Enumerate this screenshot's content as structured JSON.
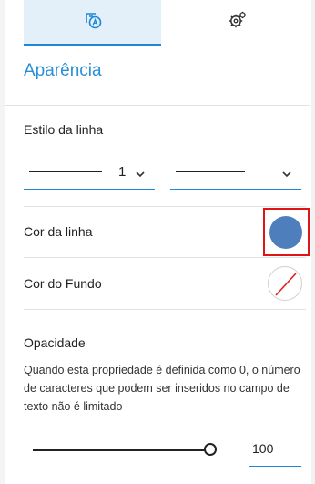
{
  "panel": {
    "section_title": "Aparência",
    "line_style_label": "Estilo da linha",
    "line_width_value": "1",
    "line_color_label": "Cor da linha",
    "background_color_label": "Cor do Fundo",
    "opacity_label": "Opacidade",
    "opacity_description": "Quando esta propriedade é definida como 0, o número de caracteres que podem ser inseridos no campo de texto não é limitado",
    "opacity_value": "100",
    "opacity_level": 1.0
  },
  "tabs": [
    {
      "icon": "appearance-icon",
      "active": true
    },
    {
      "icon": "gear-icon",
      "active": false
    }
  ],
  "colors": {
    "accent": "#1e88d6",
    "line_color": "#4e7fbc",
    "highlight": "#e01414"
  }
}
